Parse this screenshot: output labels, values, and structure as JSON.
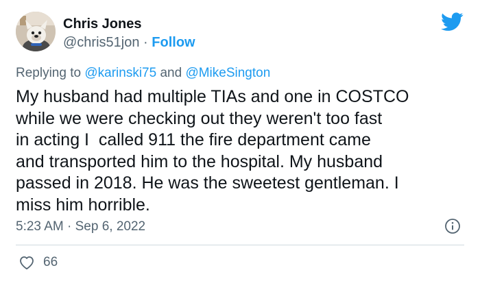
{
  "author": {
    "name": "Chris Jones",
    "handle": "@chris51jon",
    "separator": "·",
    "follow_label": "Follow"
  },
  "reply": {
    "prefix": "Replying to",
    "mention_1": "@karinski75",
    "conjunction": "and",
    "mention_2": "@MikeSington"
  },
  "tweet": {
    "lines": [
      "My husband had multiple TIAs and one in COSTCO",
      "while we were checking out they weren't too fast",
      "in acting I  called 911 the fire department came",
      "and transported him to the hospital. My husband",
      "passed in 2018. He was the sweetest gentleman. I",
      "miss him horrible."
    ]
  },
  "meta": {
    "time": "5:23 AM",
    "separator": "·",
    "date": "Sep 6, 2022"
  },
  "engagement": {
    "likes": "66"
  },
  "colors": {
    "brand_blue": "#1d9bf0",
    "text_primary": "#0f1419",
    "text_secondary": "#536471",
    "divider": "#cfd9de"
  },
  "icons": {
    "brand": "bird-logo-icon",
    "info": "info-icon",
    "like": "heart-icon"
  }
}
